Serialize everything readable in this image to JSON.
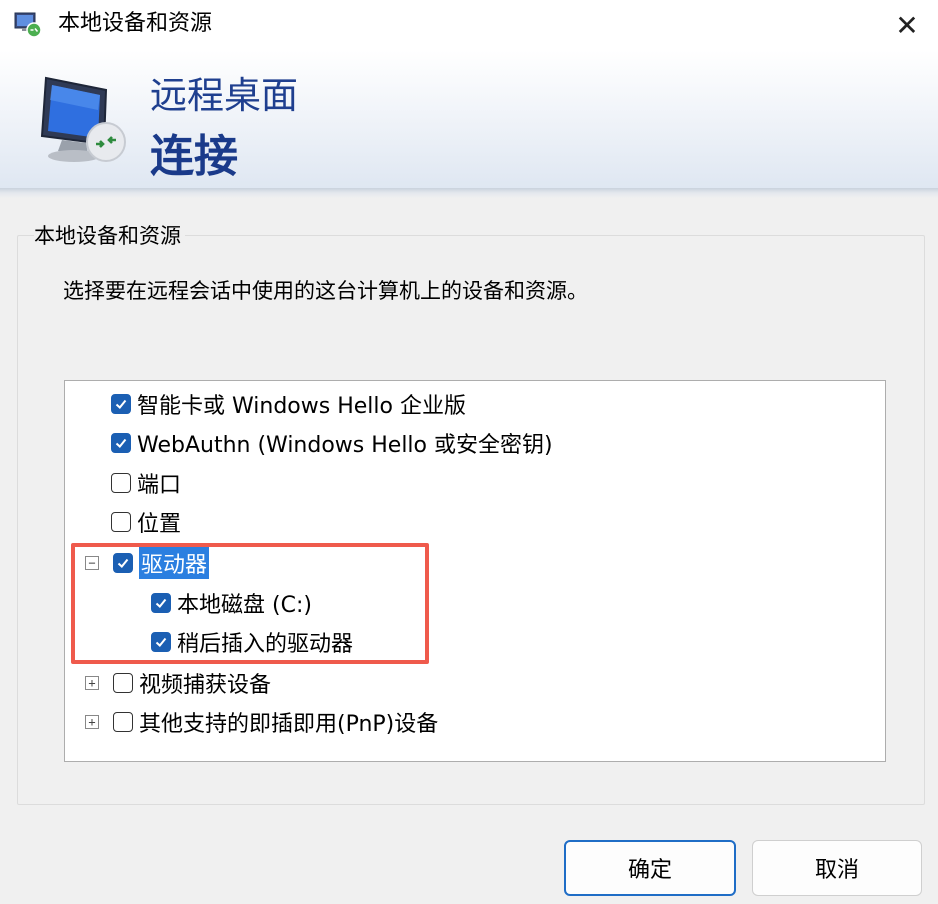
{
  "window": {
    "title": "本地设备和资源",
    "close_label": "✕"
  },
  "banner": {
    "line1": "远程桌面",
    "line2": "连接"
  },
  "group": {
    "legend": "本地设备和资源",
    "description": "选择要在远程会话中使用的这台计算机上的设备和资源。"
  },
  "list": {
    "items": [
      {
        "label": "智能卡或 Windows Hello 企业版",
        "checked": true
      },
      {
        "label": "WebAuthn (Windows Hello 或安全密钥)",
        "checked": true
      },
      {
        "label": "端口",
        "checked": false
      },
      {
        "label": "位置",
        "checked": false
      },
      {
        "label": "驱动器",
        "checked": true,
        "expander": "−",
        "selected": true
      },
      {
        "label": "本地磁盘 (C:)",
        "checked": true
      },
      {
        "label": "稍后插入的驱动器",
        "checked": true
      },
      {
        "label": "视频捕获设备",
        "checked": false,
        "expander": "+"
      },
      {
        "label": "其他支持的即插即用(PnP)设备",
        "checked": false,
        "expander": "+"
      }
    ]
  },
  "buttons": {
    "ok": "确定",
    "cancel": "取消"
  },
  "colors": {
    "accent": "#1b5fb3",
    "selection": "#2b7fe0",
    "annotation": "#ef5a4c",
    "banner_text": "#1f3f8f"
  }
}
